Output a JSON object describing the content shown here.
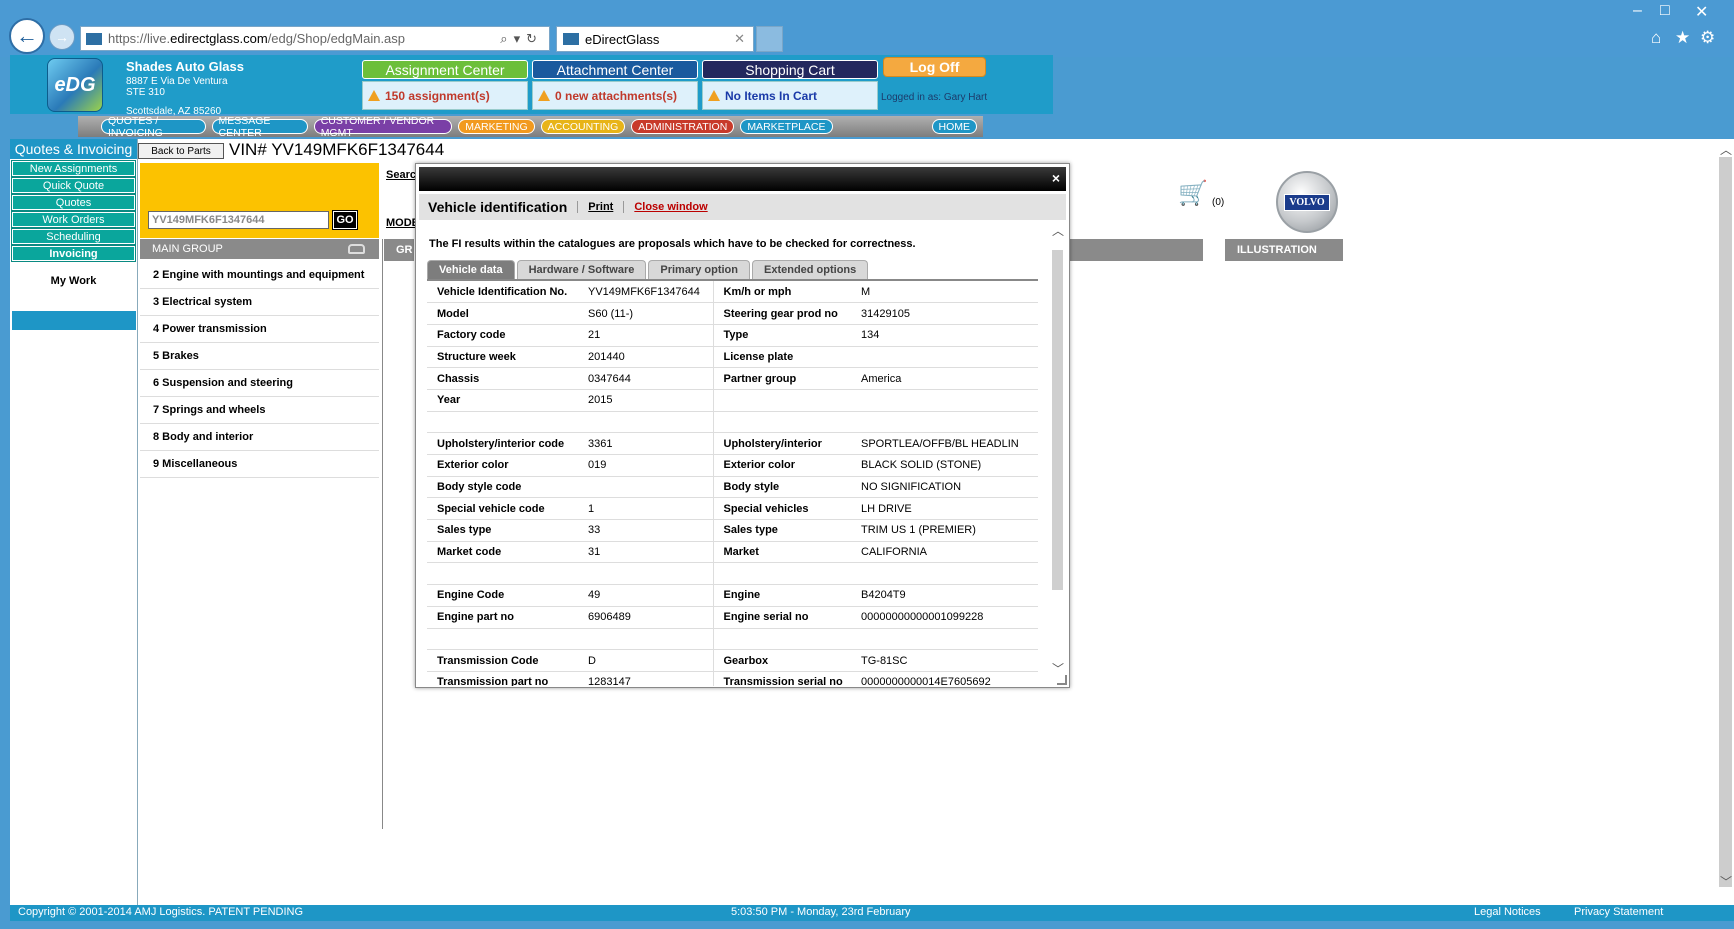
{
  "browser": {
    "url_prefix": "https://live.",
    "url_host": "edirectglass.com",
    "url_path": "/edg/Shop/edgMain.asp",
    "tab_title": "eDirectGlass"
  },
  "header": {
    "logo_text": "eDG",
    "company_name": "Shades Auto Glass",
    "address_line1": "8887 E Via De Ventura",
    "address_line2": "STE 310",
    "city_line": "Scottsdale, AZ 85260",
    "assignment_center": "Assignment Center",
    "attachment_center": "Attachment Center",
    "shopping_cart": "Shopping Cart",
    "assignments_status": "150 assignment(s)",
    "attachments_status": "0 new attachments(s)",
    "cart_status": "No Items In Cart",
    "logoff": "Log Off",
    "logged_in": "Logged in as: Gary Hart"
  },
  "menu": [
    {
      "label": "QUOTES / INVOICING",
      "color": "#1e96c6"
    },
    {
      "label": "MESSAGE CENTER",
      "color": "#1e96c6"
    },
    {
      "label": "CUSTOMER / VENDOR MGMT",
      "color": "#7a3fa6"
    },
    {
      "label": "MARKETING",
      "color": "#f29a1e"
    },
    {
      "label": "ACCOUNTING",
      "color": "#e8b418"
    },
    {
      "label": "ADMINISTRATION",
      "color": "#c83a2a"
    },
    {
      "label": "MARKETPLACE",
      "color": "#1e96c6"
    }
  ],
  "menu_home": "HOME",
  "sidebar": {
    "title": "Quotes & Invoicing",
    "items": [
      {
        "label": "New Assignments"
      },
      {
        "label": "Quick Quote"
      },
      {
        "label": "Quotes"
      },
      {
        "label": "Work Orders"
      },
      {
        "label": "Scheduling"
      },
      {
        "label": "Invoicing"
      }
    ],
    "my_work": "My Work"
  },
  "parts": {
    "back_button": "Back to Parts",
    "vin_title": "VIN# YV149MFK6F1347644",
    "vin_input_value": "YV149MFK6F1347644",
    "go": "GO",
    "search_label": "Searc",
    "model_label": "MODE",
    "main_group_header": "MAIN GROUP",
    "group_header": "GR",
    "illustration_header": "ILLUSTRATION",
    "cart_count": "(0)",
    "brand_badge": "VOLVO",
    "main_groups": [
      "2 Engine with mountings and equipment",
      "3 Electrical system",
      "4 Power transmission",
      "5 Brakes",
      "6 Suspension and steering",
      "7 Springs and wheels",
      "8 Body and interior",
      "9 Miscellaneous"
    ]
  },
  "modal": {
    "title": "Vehicle identification",
    "print": "Print",
    "close_window": "Close window",
    "close_x": "×",
    "note": "The FI results within the catalogues are proposals which have to be checked for correctness.",
    "tabs": [
      "Vehicle data",
      "Hardware / Software",
      "Primary option",
      "Extended options"
    ],
    "rows": [
      [
        "Vehicle Identification No.",
        "YV149MFK6F1347644",
        "Km/h or mph",
        "M"
      ],
      [
        "Model",
        "S60 (11-)",
        "Steering gear prod no",
        "31429105"
      ],
      [
        "Factory code",
        "21",
        "Type",
        "134"
      ],
      [
        "Structure week",
        "201440",
        "License plate",
        ""
      ],
      [
        "Chassis",
        "0347644",
        "Partner group",
        "America"
      ],
      [
        "Year",
        "2015",
        "",
        ""
      ],
      [
        "",
        "",
        "",
        ""
      ],
      [
        "Upholstery/interior code",
        "3361",
        "Upholstery/interior",
        "SPORTLEA/OFFB/BL HEADLIN"
      ],
      [
        "Exterior color",
        "019",
        "Exterior color",
        "BLACK SOLID (STONE)"
      ],
      [
        "Body style code",
        "",
        "Body style",
        "NO SIGNIFICATION"
      ],
      [
        "Special vehicle code",
        "1",
        "Special vehicles",
        "LH DRIVE"
      ],
      [
        "Sales type",
        "33",
        "Sales type",
        "TRIM US 1 (PREMIER)"
      ],
      [
        "Market code",
        "31",
        "Market",
        "CALIFORNIA"
      ],
      [
        "",
        "",
        "",
        ""
      ],
      [
        "Engine Code",
        "49",
        "Engine",
        "B4204T9"
      ],
      [
        "Engine part no",
        "6906489",
        "Engine serial no",
        "00000000000001099228"
      ],
      [
        "",
        "",
        "",
        ""
      ],
      [
        "Transmission Code",
        "D",
        "Gearbox",
        "TG-81SC"
      ],
      [
        "Transmission part no",
        "1283147",
        "Transmission serial no",
        "0000000000014E7605692"
      ]
    ]
  },
  "footer": {
    "copyright": "Copyright © 2001-2014 AMJ Logistics. PATENT PENDING",
    "datetime": "5:03:50 PM - Monday, 23rd February",
    "legal": "Legal Notices",
    "privacy": "Privacy Statement"
  }
}
